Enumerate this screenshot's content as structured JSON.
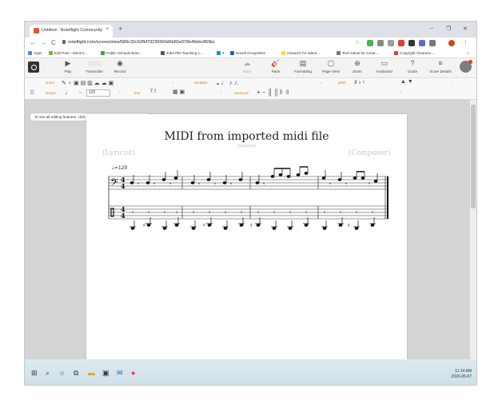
{
  "browser": {
    "tab_title": "Untitled - Noteflight Community",
    "tab_close": "×",
    "new_tab": "+",
    "url": "noteflight.com/scores/view/589c32c62fbf79236560d6b82e976b49ebc869bc",
    "window_controls": [
      "–",
      "❐",
      "✕"
    ],
    "nav": {
      "back": "←",
      "forward": "→",
      "reload": "C"
    },
    "bookmarks": [
      {
        "label": "Apps",
        "color": "#4a86e8"
      },
      {
        "label": "Edit Post ‹ Steve's...",
        "color": "#7cb342"
      },
      {
        "label": "Public Schools Bran...",
        "color": "#43a047"
      },
      {
        "label": "Jobs PEI-Teaching L...",
        "color": "#555555"
      },
      {
        "label": "4",
        "color": "#1e88e5"
      },
      {
        "label": "Novell GroupWise",
        "color": "#1565c0"
      },
      {
        "label": "research for talent...",
        "color": "#fdd835"
      },
      {
        "label": "Tech Ideas for Creat...",
        "color": "#777777"
      },
      {
        "label": "Copyright Clearanc...",
        "color": "#e53935"
      }
    ],
    "bookmarks_more": "»"
  },
  "toolbar": {
    "items": [
      {
        "label": "Play",
        "icon": "▶"
      },
      {
        "label": "Transcribe",
        "icon": "◌◌◌"
      },
      {
        "label": "Record",
        "icon": "◉"
      },
      {
        "label": "Save",
        "icon": "☁"
      },
      {
        "label": "Parts",
        "icon": "🎸"
      },
      {
        "label": "Formatting",
        "icon": "▤"
      },
      {
        "label": "Page View",
        "icon": "▢"
      },
      {
        "label": "Zoom",
        "icon": "⊕"
      },
      {
        "label": "Keyboard",
        "icon": "▭"
      },
      {
        "label": "Guide",
        "icon": "?"
      },
      {
        "label": "Score Details",
        "icon": "≡"
      }
    ]
  },
  "palette": {
    "score_label": "score",
    "duration_label": "duration",
    "pitch_label": "pitch",
    "tempo_label": "tempo",
    "text_label": "text",
    "measure_label": "measure",
    "tempo_eq": "=",
    "tempo_value": "120",
    "text_symbols": "T  f",
    "duration_symbols": "𝅝  ♩  ♪  ♪.",
    "pitch_symbols": "♯  ♭  ♮",
    "arrows": "▲  ▼"
  },
  "hint": {
    "text": "To see all editing features, click or tap the menu button above."
  },
  "score": {
    "title": "MIDI from imported midi file",
    "subtitle": "(Subtitle)",
    "lyricist": "(Lyricist)",
    "composer": "(Composer)",
    "tempo_mark": "♩=120",
    "time_signature": [
      "4",
      "4"
    ],
    "clef": "𝄢"
  },
  "taskbar": {
    "time": "11:14 AM",
    "date": "2020-05-07",
    "icons": [
      "start-icon",
      "search-icon",
      "cortana-icon",
      "task-view-icon",
      "file-explorer-icon",
      "store-icon",
      "mail-icon",
      "chrome-icon"
    ]
  },
  "colors": {
    "accent": "#e07a10",
    "notification": "#e53935",
    "tab_favicon": "#e8542c"
  }
}
